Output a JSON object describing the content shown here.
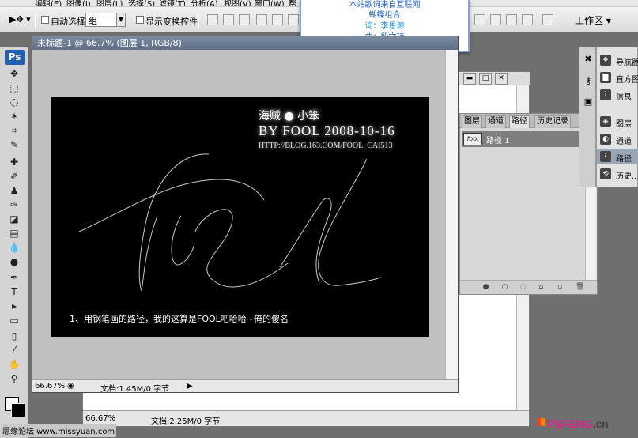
{
  "menubar": {
    "items": [
      "编辑(E)",
      "图像(I)",
      "图层(L)",
      "选择(S)",
      "滤镜(T)",
      "分析(A)",
      "视图(V)",
      "窗口(W)",
      "帮"
    ]
  },
  "options_bar": {
    "auto_select_label": "自动选择:",
    "auto_select_value": "组",
    "show_transform_label": "显示变换控件",
    "workspace_label": "工作区 ▾"
  },
  "popup": {
    "line1": "本站歌词来自互联网",
    "line2": "蝴蝶组合",
    "line3": "词：李恩源",
    "line4": "曲：殷文琦"
  },
  "doc1": {
    "title": "未标题-1 @ 66.7% (图层 1, RGB/8)",
    "zoom": "66.67%",
    "doc_info": "文档:1.45M/0 字节",
    "canvas": {
      "line1": "海贼 ● 小笨",
      "line2": "BY FOOL   2008-10-16",
      "line3": "HTTP://BLOG.163.COM/FOOL_CAI513",
      "caption": "1、用钢笔画的路径，我的这算是FOOL吧哈哈~俺的傻名"
    }
  },
  "doc2": {
    "zoom": "66.67%",
    "doc_info": "文档:2.25M/0 字节"
  },
  "paths_panel": {
    "tabs": [
      "图层",
      "通道",
      "路径",
      "历史记录"
    ],
    "active_tab": "路径",
    "path_name": "路径 1"
  },
  "dock": {
    "items": [
      "导航器",
      "直方图",
      "信息",
      "图层",
      "通道",
      "路径",
      "历史..."
    ]
  },
  "toolbar": {
    "logo": "Ps",
    "bottom_text": "思缘论坛 www.missyuan.com"
  },
  "watermark": {
    "text1": "PSFENG",
    "text2": ".cn"
  },
  "colors": {
    "foreground": "#ffffff",
    "background": "#000000",
    "ps_blue": "#1e5fb4"
  }
}
